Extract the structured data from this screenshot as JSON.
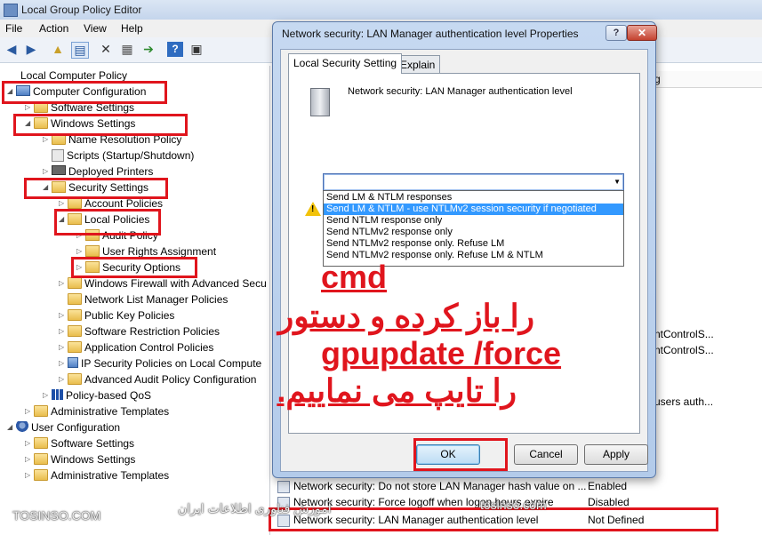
{
  "window": {
    "title": "Local Group Policy Editor"
  },
  "menu": [
    "File",
    "Action",
    "View",
    "Help"
  ],
  "tree": {
    "root": "Local Computer Policy",
    "computer_configuration": "Computer Configuration",
    "software_settings": "Software Settings",
    "windows_settings": "Windows Settings",
    "name_resolution_policy": "Name Resolution Policy",
    "scripts": "Scripts (Startup/Shutdown)",
    "deployed_printers": "Deployed Printers",
    "security_settings": "Security Settings",
    "account_policies": "Account Policies",
    "local_policies": "Local Policies",
    "audit_policy": "Audit Policy",
    "user_rights": "User Rights Assignment",
    "security_options": "Security Options",
    "windows_firewall": "Windows Firewall with Advanced Secu",
    "network_list": "Network List Manager Policies",
    "public_key": "Public Key Policies",
    "software_restriction": "Software Restriction Policies",
    "app_control": "Application Control Policies",
    "ip_security": "IP Security Policies on Local Compute",
    "advanced_audit": "Advanced Audit Policy Configuration",
    "qos": "Policy-based QoS",
    "admin_templates": "Administrative Templates",
    "user_configuration": "User Configuration",
    "user_software_settings": "Software Settings",
    "user_windows_settings": "Windows Settings",
    "user_admin_templates": "Administrative Templates"
  },
  "background_list": {
    "col_header_fragment": "g",
    "frag1": "ntControlS...",
    "frag2": "ntControlS...",
    "frag3": "users auth...",
    "rows": [
      {
        "name": "Network security: Do not store LAN Manager hash value on ...",
        "setting": "Enabled"
      },
      {
        "name": "Network security: Force logoff when logon hours expire",
        "setting": "Disabled"
      },
      {
        "name": "Network security: LAN Manager authentication level",
        "setting": "Not Defined"
      }
    ]
  },
  "dialog": {
    "title": "Network security: LAN Manager authentication level Properties",
    "help": "?",
    "close": "✕",
    "tabs": [
      "Local Security Setting",
      "Explain"
    ],
    "policy_name": "Network security: LAN Manager authentication level",
    "options": [
      "Send LM & NTLM responses",
      "Send LM & NTLM - use NTLMv2 session security if negotiated",
      "Send NTLM response only",
      "Send NTLMv2 response only",
      "Send NTLMv2 response only. Refuse LM",
      "Send NTLMv2 response only. Refuse LM & NTLM"
    ],
    "selected_option_index": 1,
    "buttons": {
      "ok": "OK",
      "cancel": "Cancel",
      "apply": "Apply"
    }
  },
  "overlay_text": {
    "line1": "cmd",
    "line2": "را باز کرده و دستور",
    "line3": "gpupdate /force",
    "line4": "را تایپ می نماییم."
  },
  "watermarks": {
    "left": "TOSINSO.COM",
    "right": "آموزش فناوری اطلاعات ایران",
    "center": "tosinso.com"
  },
  "colors": {
    "highlight_box": "#e0151d",
    "selection": "#3399ff",
    "overlay_text": "#e0151d"
  }
}
